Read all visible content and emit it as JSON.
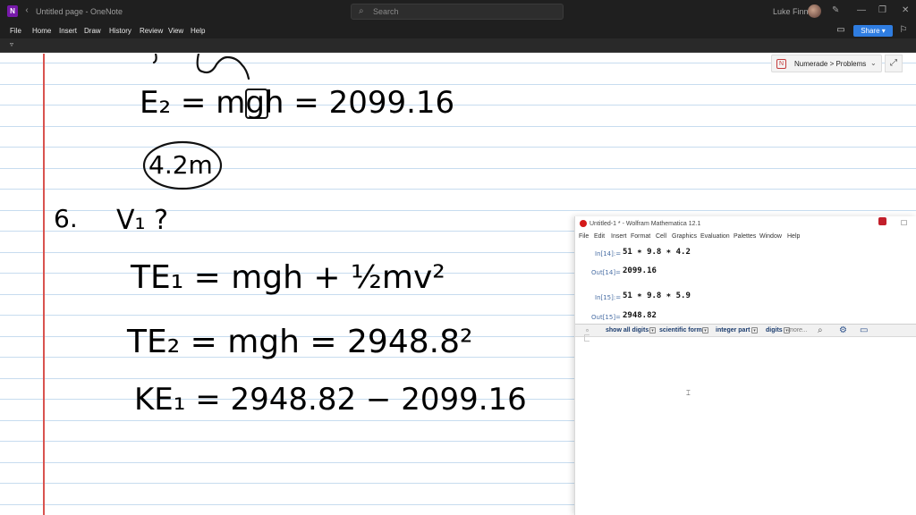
{
  "window": {
    "title": "Untitled page - OneNote",
    "search_placeholder": "Search",
    "user_name": "Luke Finney"
  },
  "menu": {
    "tabs": [
      "File",
      "Home",
      "Insert",
      "Draw",
      "History",
      "Review",
      "View",
      "Help"
    ],
    "share_label": "Share"
  },
  "notebook": {
    "chip_label": "Numerade > Problems"
  },
  "handwriting": {
    "line1": "E₂ = mgh = 2099.16",
    "circled": "4.2m",
    "problem_number": "6.",
    "question": "V₁ ?",
    "line2": "TE₁ = mgh + ½mv²",
    "line3": "TE₂ = mgh = 2948.8²",
    "line4": "KE₁ = 2948.82 − 2099.16"
  },
  "mathematica": {
    "title": "Untitled-1 * - Wolfram Mathematica 12.1",
    "menus": [
      "File",
      "Edit",
      "Insert",
      "Format",
      "Cell",
      "Graphics",
      "Evaluation",
      "Palettes",
      "Window",
      "Help"
    ],
    "cells": [
      {
        "in_label": "In[14]:=",
        "input": "51 ∗ 9.8 ∗ 4.2",
        "out_label": "Out[14]=",
        "output": "2099.16"
      },
      {
        "in_label": "In[15]:=",
        "input": "51 ∗ 9.8 ∗ 5.9",
        "out_label": "Out[15]=",
        "output": "2948.82"
      }
    ],
    "suggestions": [
      "show all digits",
      "scientific form",
      "integer part",
      "digits",
      "more..."
    ]
  }
}
